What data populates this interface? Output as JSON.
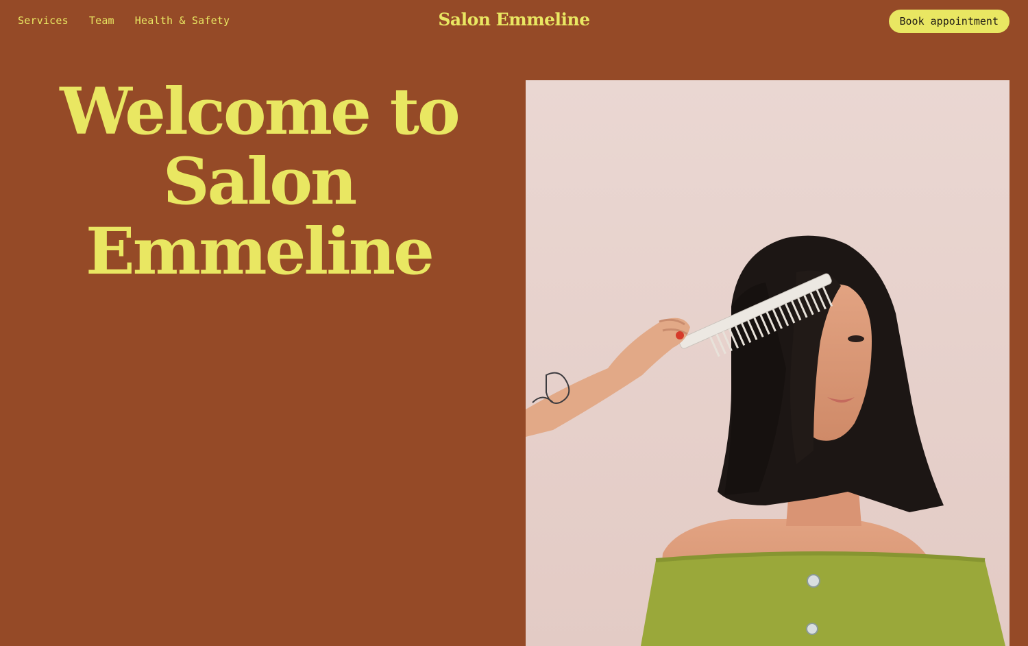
{
  "nav": {
    "items": [
      {
        "label": "Services"
      },
      {
        "label": "Team"
      },
      {
        "label": "Health & Safety"
      }
    ]
  },
  "brand": {
    "name": "Salon Emmeline"
  },
  "header": {
    "cta_label": "Book appointment"
  },
  "hero": {
    "heading_line1": "Welcome to",
    "heading_line2": "Salon",
    "heading_line3": "Emmeline"
  },
  "colors": {
    "background": "#954a27",
    "accent": "#e9e762",
    "photo_backdrop": "#e8d3cf",
    "top_green": "#9aa83a",
    "hair": "#1c1614"
  }
}
